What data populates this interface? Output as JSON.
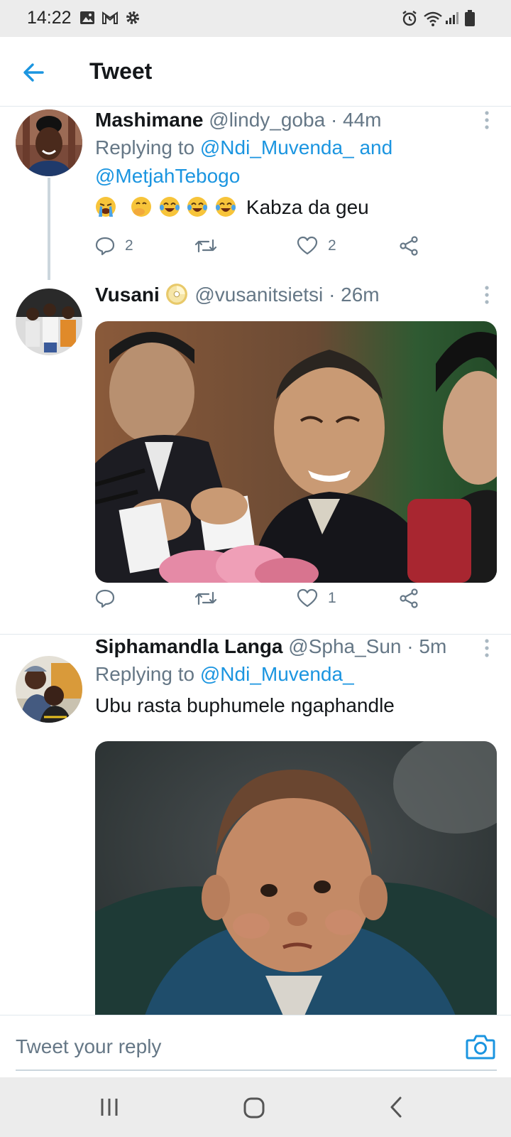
{
  "status_bar": {
    "time": "14:22",
    "left_icons": [
      "image-icon",
      "gmail-icon",
      "gear-icon"
    ],
    "right_icons": [
      "alarm-icon",
      "wifi-icon",
      "signal-icon",
      "battery-icon"
    ]
  },
  "header": {
    "back_icon": "arrow-left-icon",
    "title": "Tweet"
  },
  "tweets": [
    {
      "name": "Mashimane",
      "handle": "@lindy_goba",
      "time": "· 44m",
      "replying_label": "Replying to",
      "mentions": [
        "@Ndi_Muvenda_",
        "@MetjahTebogo"
      ],
      "mention_joiner": "and",
      "emojis": [
        "loudly-crying-face",
        "hand-over-mouth-face",
        "tears-of-joy-face",
        "tears-of-joy-face",
        "tears-of-joy-face"
      ],
      "text": "Kabza da geu",
      "actions": {
        "reply_count": "2",
        "retweet_count": "",
        "like_count": "2"
      }
    },
    {
      "name": "Vusani",
      "name_emoji": "dvd-disc",
      "handle": "@vusanitsietsi",
      "time": "· 26m",
      "media": "photo-laughing-man-at-conference",
      "actions": {
        "reply_count": "",
        "retweet_count": "",
        "like_count": "1"
      }
    },
    {
      "name": "Siphamandla Langa",
      "handle": "@Spha_Sun",
      "time": "· 5m",
      "replying_label": "Replying to",
      "mentions": [
        "@Ndi_Muvenda_"
      ],
      "text": "Ubu rasta buphumele ngaphandle",
      "media": "photo-child-in-blue-suit"
    }
  ],
  "reply_bar": {
    "placeholder": "Tweet your reply",
    "camera_icon": "camera-icon"
  },
  "nav_bar": {
    "buttons": [
      "recent-apps-icon",
      "home-icon",
      "back-icon"
    ]
  },
  "colors": {
    "accent": "#1b95e0",
    "secondary_text": "#657786",
    "divider": "#e1e8ed",
    "system_bar": "#ececec"
  }
}
